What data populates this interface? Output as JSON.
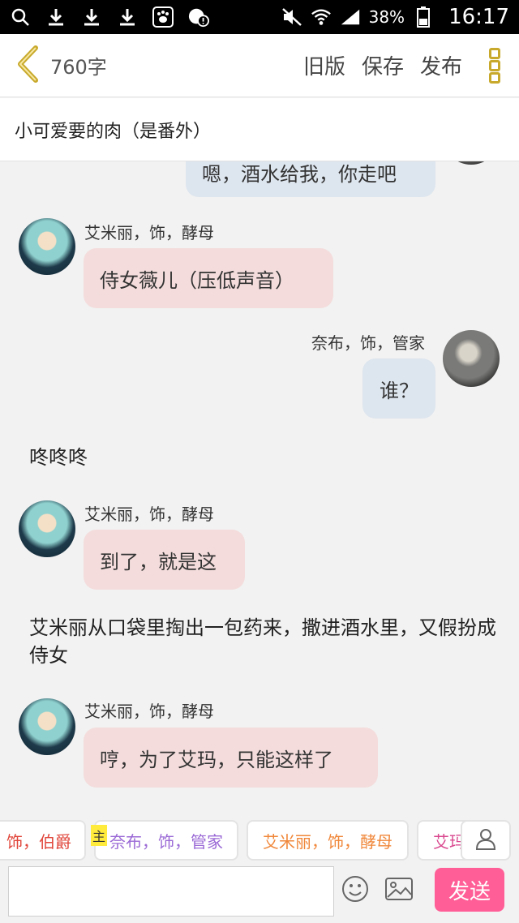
{
  "status_bar": {
    "battery": "38%",
    "time": "16:17",
    "icons": [
      "search-icon",
      "download-icon",
      "download-icon",
      "download-icon",
      "baidu-paw-icon",
      "cloud-alert-icon",
      "mute-icon",
      "wifi-icon",
      "signal-icon",
      "battery-icon"
    ]
  },
  "toolbar": {
    "word_count": "760字",
    "old_version": "旧版",
    "save": "保存",
    "publish": "发布"
  },
  "story": {
    "title": "小可爱要的肉（是番外）"
  },
  "messages": [
    {
      "type": "bubble",
      "side": "right",
      "text": "嗯，酒水给我，你走吧"
    },
    {
      "type": "bubble",
      "side": "left",
      "name": "艾米丽，饰，酵母",
      "text": "侍女薇儿（压低声音）"
    },
    {
      "type": "bubble",
      "side": "right",
      "name": "奈布，饰，管家",
      "text": "谁？"
    },
    {
      "type": "narration",
      "text": "咚咚咚"
    },
    {
      "type": "bubble",
      "side": "left",
      "name": "艾米丽，饰，酵母",
      "text": "到了，就是这"
    },
    {
      "type": "narration",
      "text": "艾米丽从口袋里掏出一包药来，撒进酒水里，又假扮成侍女"
    },
    {
      "type": "bubble",
      "side": "left",
      "name": "艾米丽，饰，酵母",
      "text": "哼，为了艾玛，只能这样了"
    }
  ],
  "roles": {
    "badge": "主",
    "items": [
      {
        "label": "饰，伯爵",
        "color": "#e0453a"
      },
      {
        "label": "奈布，饰，管家",
        "color": "#9b6ad6"
      },
      {
        "label": "艾米丽，饰，酵母",
        "color": "#f0873a"
      },
      {
        "label": "艾玛",
        "color": "#d9488f"
      }
    ]
  },
  "composer": {
    "input_value": "",
    "send": "发送"
  },
  "colors": {
    "left_bubble": "#f4dcdc",
    "right_bubble": "#dde5ee",
    "send_button": "#ff5f96",
    "back_arrow": "#c8a92b"
  }
}
